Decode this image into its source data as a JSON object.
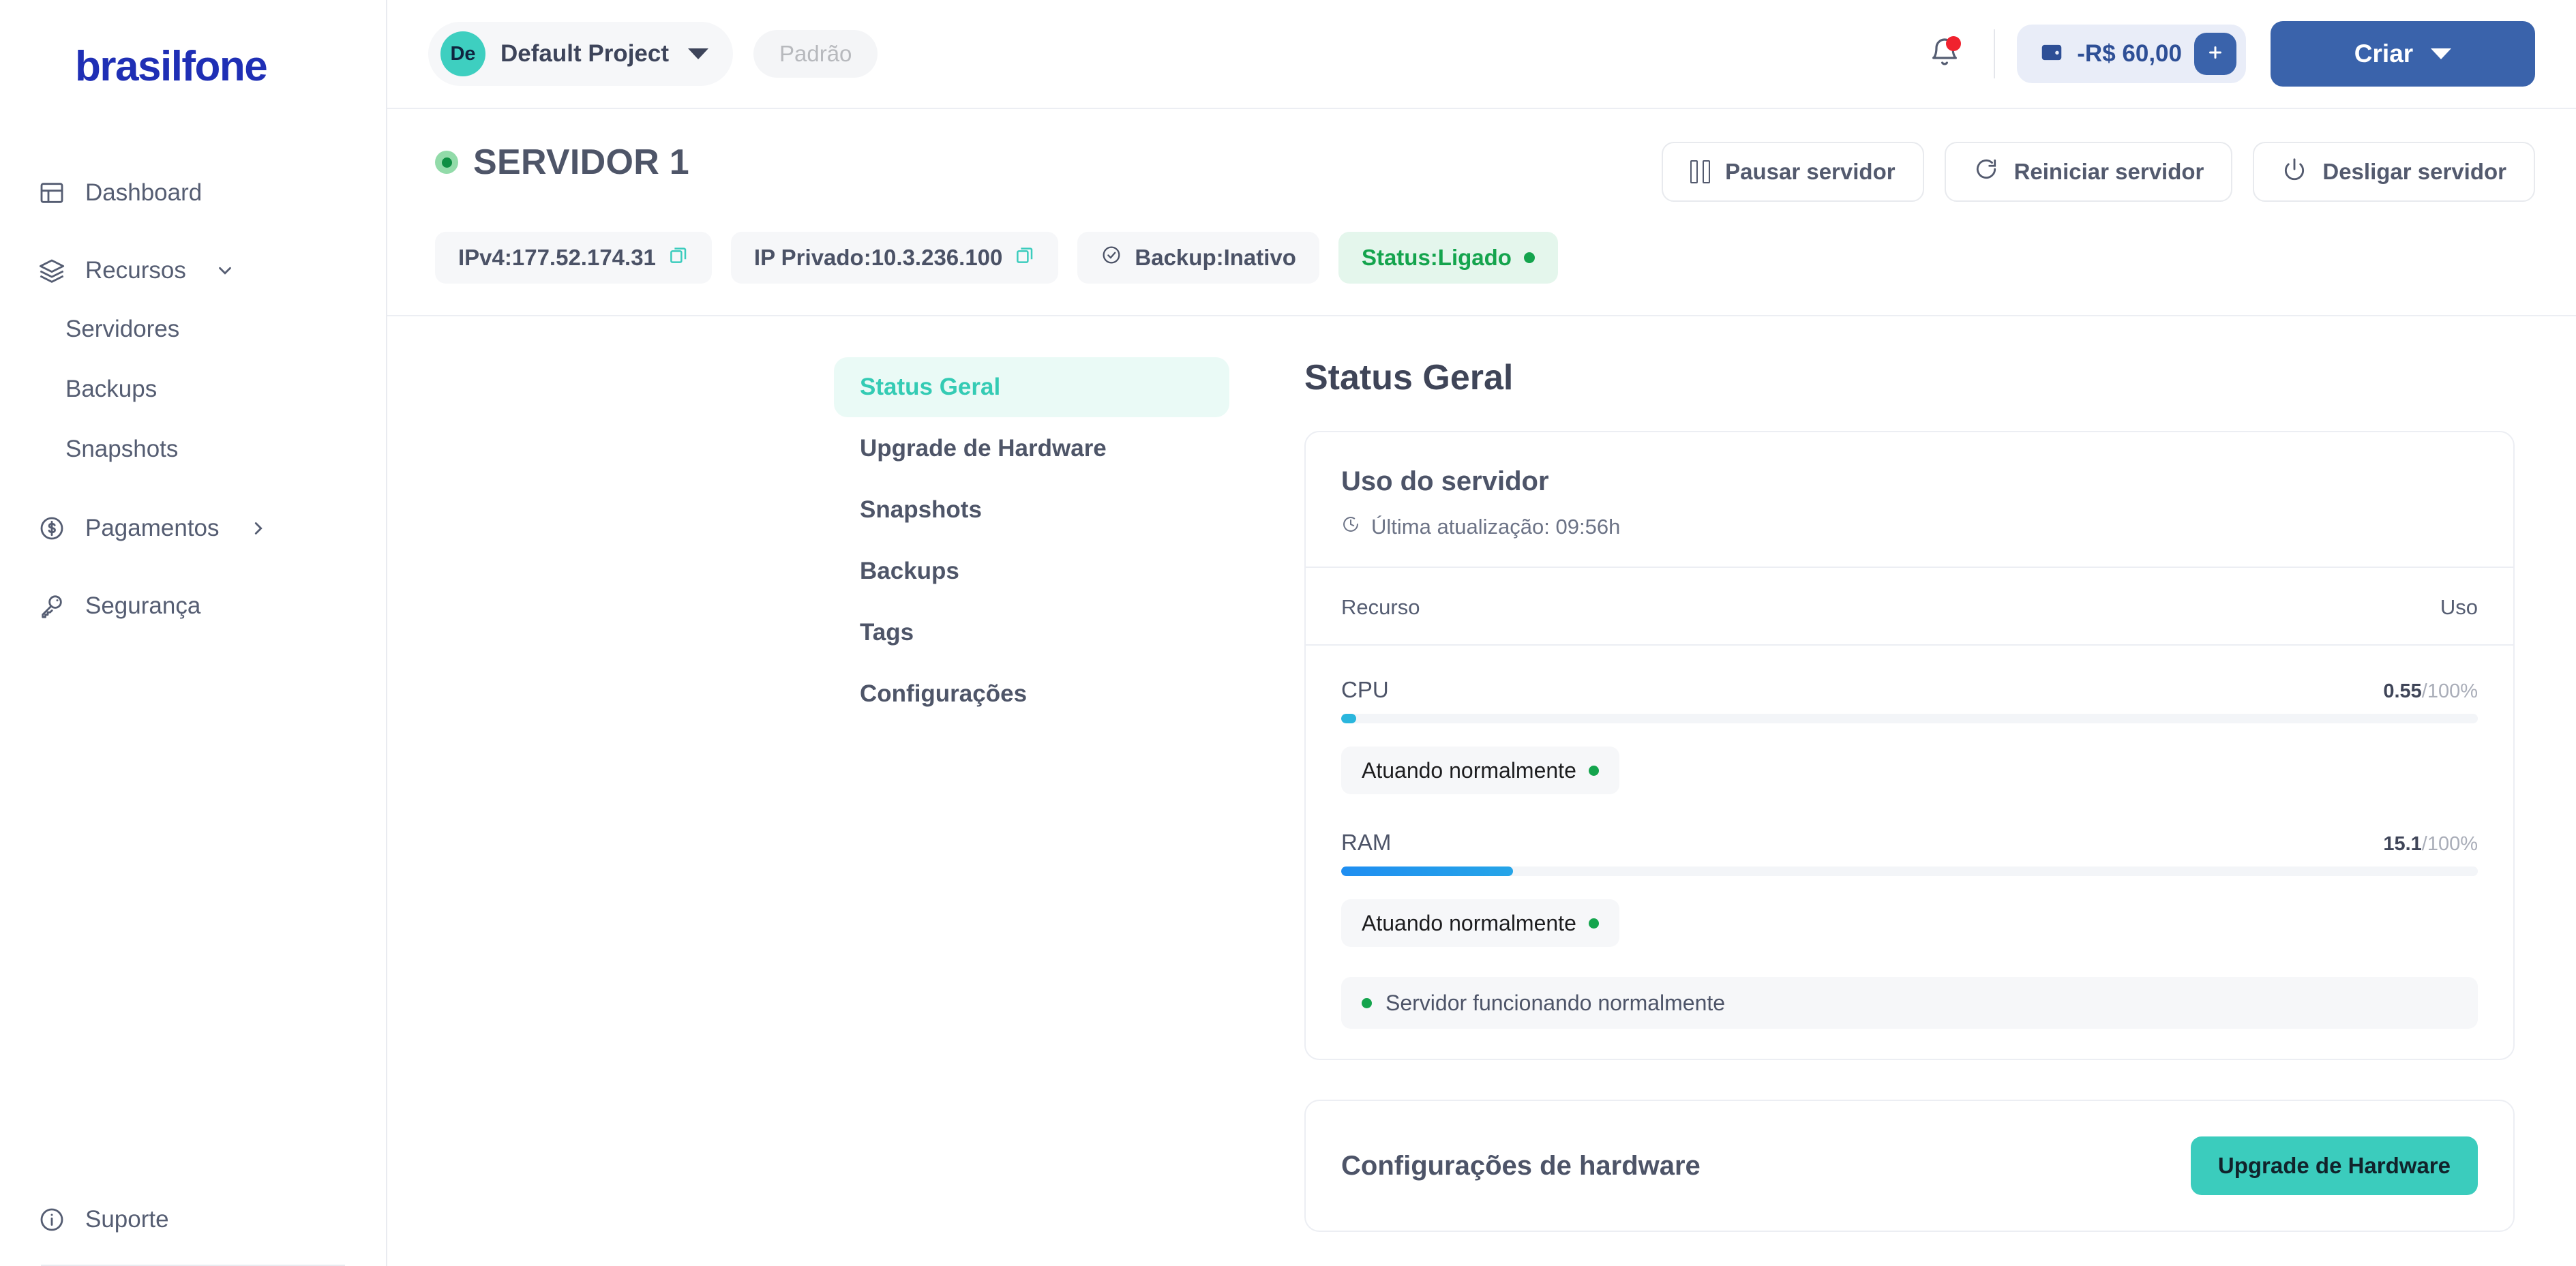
{
  "brand": {
    "logo_text": "brasilfone"
  },
  "sidebar": {
    "items": [
      {
        "label": "Dashboard",
        "icon": "dashboard-icon"
      },
      {
        "label": "Recursos",
        "icon": "layers-icon",
        "caret": "chevron-down-icon"
      },
      {
        "label": "Pagamentos",
        "icon": "dollar-circle-icon",
        "caret": "chevron-right-icon"
      },
      {
        "label": "Segurança",
        "icon": "key-icon"
      }
    ],
    "recursos_children": [
      "Servidores",
      "Backups",
      "Snapshots"
    ],
    "support": {
      "label": "Suporte",
      "icon": "info-circle-icon"
    }
  },
  "topbar": {
    "project": {
      "avatar_initials": "De",
      "name": "Default Project",
      "caret": "chevron-down-icon"
    },
    "badge": "Padrão",
    "bell_icon": "bell-icon",
    "balance": {
      "icon": "wallet-icon",
      "amount": "-R$ 60,00",
      "add_icon": "plus-icon"
    },
    "create_button": {
      "label": "Criar",
      "caret": "chevron-down-icon"
    }
  },
  "server": {
    "name": "SERVIDOR 1",
    "status_indicator": "online-dot",
    "actions": [
      {
        "label": "Pausar servidor",
        "icon": "pause-icon"
      },
      {
        "label": "Reiniciar servidor",
        "icon": "refresh-icon"
      },
      {
        "label": "Desligar servidor",
        "icon": "power-icon"
      }
    ],
    "chips": [
      {
        "label": "IPv4:177.52.174.31",
        "icon": "copy-icon",
        "style": "default"
      },
      {
        "label": "IP Privado:10.3.236.100",
        "icon": "copy-icon",
        "style": "default"
      },
      {
        "label": "Backup:Inativo",
        "icon": "clock-check-icon",
        "style": "default"
      },
      {
        "label": "Status:Ligado",
        "icon": "green-dot",
        "style": "green"
      }
    ]
  },
  "tabs": [
    {
      "label": "Status Geral",
      "active": true
    },
    {
      "label": "Upgrade de Hardware",
      "active": false
    },
    {
      "label": "Snapshots",
      "active": false
    },
    {
      "label": "Backups",
      "active": false
    },
    {
      "label": "Tags",
      "active": false
    },
    {
      "label": "Configurações",
      "active": false
    }
  ],
  "panel": {
    "title": "Status Geral",
    "usage_card": {
      "title": "Uso do servidor",
      "last_update_icon": "clock-icon",
      "last_update": "Última atualização: 09:56h",
      "columns": {
        "resource": "Recurso",
        "usage": "Uso"
      },
      "rows": [
        {
          "name": "CPU",
          "value": "0.55",
          "total": "/100%",
          "percent": 0.55,
          "status": "Atuando normalmente",
          "status_dot": "green-dot"
        },
        {
          "name": "RAM",
          "value": "15.1",
          "total": "/100%",
          "percent": 15.1,
          "status": "Atuando normalmente",
          "status_dot": "green-dot"
        }
      ],
      "footer": {
        "text": "Servidor funcionando normalmente",
        "dot": "green-dot"
      }
    },
    "hardware_card": {
      "title": "Configurações de hardware",
      "upgrade_button": "Upgrade de Hardware"
    }
  },
  "colors": {
    "brand_blue": "#1f2fb5",
    "primary_blue": "#3a63ab",
    "teal": "#3bccbd",
    "teal_text": "#34cbb4",
    "green": "#14a44d",
    "text": "#4d5468"
  }
}
